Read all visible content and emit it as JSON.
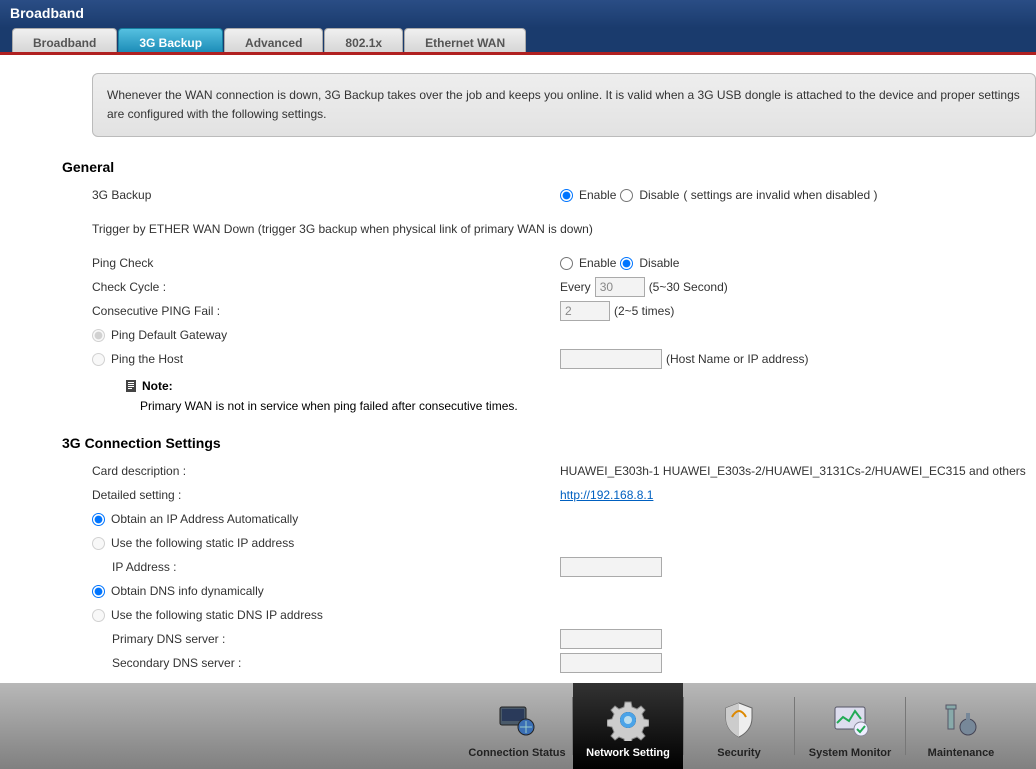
{
  "header": {
    "title": "Broadband"
  },
  "tabs": [
    {
      "label": "Broadband"
    },
    {
      "label": "3G Backup"
    },
    {
      "label": "Advanced"
    },
    {
      "label": "802.1x"
    },
    {
      "label": "Ethernet WAN"
    }
  ],
  "intro": "Whenever the WAN connection is down, 3G Backup takes over the job and keeps you online. It is valid when a 3G USB dongle is attached to the device and proper settings are configured with the following settings.",
  "general": {
    "title": "General",
    "backup_label": "3G Backup",
    "enable": "Enable",
    "disable": "Disable",
    "backup_hint": "( settings are invalid when disabled )",
    "trigger_text": "Trigger by ETHER WAN Down (trigger 3G backup when physical link of primary WAN is down)",
    "pingcheck_label": "Ping Check",
    "checkcycle_label": "Check Cycle :",
    "checkcycle_prefix": "Every",
    "checkcycle_value": "30",
    "checkcycle_hint": "(5~30 Second)",
    "consecfail_label": "Consecutive PING Fail :",
    "consecfail_value": "2",
    "consecfail_hint": "(2~5 times)",
    "ping_default_gw": "Ping Default Gateway",
    "ping_host": "Ping the Host",
    "ping_host_value": "",
    "ping_host_hint": "(Host Name or IP address)",
    "note_title": "Note:",
    "note_body": "Primary WAN is not in service when ping failed after consecutive times."
  },
  "conn": {
    "title": "3G Connection Settings",
    "card_desc_label": "Card description :",
    "card_desc_value": "HUAWEI_E303h-1 HUAWEI_E303s-2/HUAWEI_3131Cs-2/HUAWEI_EC315 and others",
    "detail_label": "Detailed setting :",
    "detail_link": "http://192.168.8.1",
    "obtain_ip_auto": "Obtain an IP Address Automatically",
    "use_static_ip": "Use the following static IP address",
    "ip_addr_label": "IP Address :",
    "ip_addr_value": "",
    "obtain_dns_auto": "Obtain DNS info dynamically",
    "use_static_dns": "Use the following static DNS IP address",
    "primary_dns_label": "Primary DNS server :",
    "primary_dns_value": "",
    "secondary_dns_label": "Secondary DNS server :",
    "secondary_dns_value": ""
  },
  "bottom_nav": [
    {
      "label": "Connection Status"
    },
    {
      "label": "Network Setting"
    },
    {
      "label": "Security"
    },
    {
      "label": "System Monitor"
    },
    {
      "label": "Maintenance"
    }
  ]
}
